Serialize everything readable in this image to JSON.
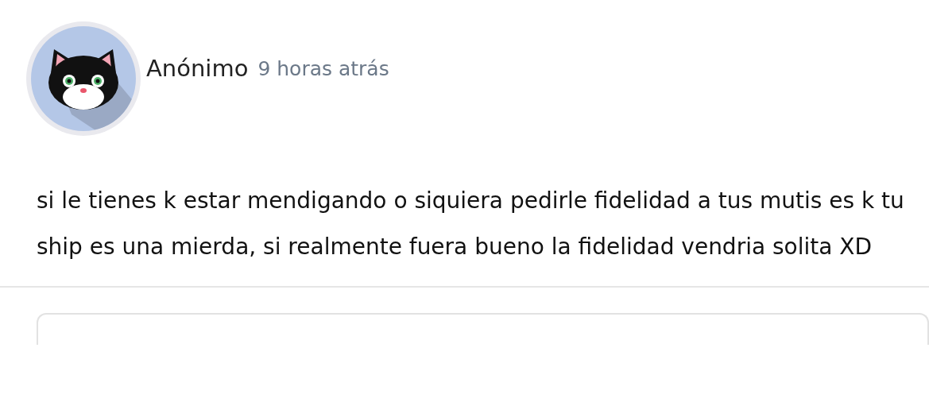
{
  "comment": {
    "author": "Anónimo",
    "time": "9 horas atrás",
    "text": "si le tienes k estar mendigando o siquiera pedirle fidelidad a tus mutis es k tu ship es una mierda, si realmente fuera bueno la fidelidad vendria solita XD"
  },
  "reply_field": {
    "kind": "field"
  }
}
